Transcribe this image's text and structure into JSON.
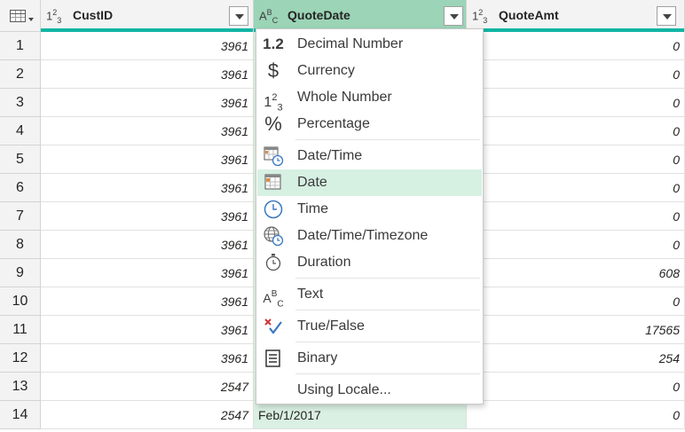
{
  "columns": [
    {
      "type_icon": "whole-number",
      "title": "CustID"
    },
    {
      "type_icon": "text",
      "title": "QuoteDate"
    },
    {
      "type_icon": "whole-number",
      "title": "QuoteAmt"
    }
  ],
  "type_glyphs": {
    "whole": "1",
    "whole_sup": "2",
    "whole_sub": "3",
    "text_a": "A",
    "text_b": "B",
    "text_c": "C"
  },
  "rows": [
    {
      "n": "1",
      "custid": "3961",
      "quotedate": "",
      "quoteamt": "0"
    },
    {
      "n": "2",
      "custid": "3961",
      "quotedate": "",
      "quoteamt": "0"
    },
    {
      "n": "3",
      "custid": "3961",
      "quotedate": "",
      "quoteamt": "0"
    },
    {
      "n": "4",
      "custid": "3961",
      "quotedate": "",
      "quoteamt": "0"
    },
    {
      "n": "5",
      "custid": "3961",
      "quotedate": "",
      "quoteamt": "0"
    },
    {
      "n": "6",
      "custid": "3961",
      "quotedate": "",
      "quoteamt": "0"
    },
    {
      "n": "7",
      "custid": "3961",
      "quotedate": "",
      "quoteamt": "0"
    },
    {
      "n": "8",
      "custid": "3961",
      "quotedate": "",
      "quoteamt": "0"
    },
    {
      "n": "9",
      "custid": "3961",
      "quotedate": "",
      "quoteamt": "608"
    },
    {
      "n": "10",
      "custid": "3961",
      "quotedate": "",
      "quoteamt": "0"
    },
    {
      "n": "11",
      "custid": "3961",
      "quotedate": "",
      "quoteamt": "17565"
    },
    {
      "n": "12",
      "custid": "3961",
      "quotedate": "",
      "quoteamt": "254"
    },
    {
      "n": "13",
      "custid": "2547",
      "quotedate": "",
      "quoteamt": "0"
    },
    {
      "n": "14",
      "custid": "2547",
      "quotedate": "Feb/1/2017",
      "quoteamt": "0"
    }
  ],
  "menu": {
    "items": [
      {
        "icon": "decimal-number",
        "glyph": "1.2",
        "label": "Decimal Number"
      },
      {
        "icon": "currency",
        "glyph": "$",
        "label": "Currency"
      },
      {
        "icon": "whole-number",
        "glyph": "123",
        "label": "Whole Number"
      },
      {
        "icon": "percentage",
        "glyph": "%",
        "label": "Percentage"
      },
      {
        "icon": "date-time",
        "glyph": "",
        "label": "Date/Time"
      },
      {
        "icon": "date",
        "glyph": "",
        "label": "Date"
      },
      {
        "icon": "time",
        "glyph": "",
        "label": "Time"
      },
      {
        "icon": "date-time-timezone",
        "glyph": "",
        "label": "Date/Time/Timezone"
      },
      {
        "icon": "duration",
        "glyph": "",
        "label": "Duration"
      },
      {
        "icon": "text",
        "glyph": "ABC",
        "label": "Text"
      },
      {
        "icon": "true-false",
        "glyph": "",
        "label": "True/False"
      },
      {
        "icon": "binary",
        "glyph": "",
        "label": "Binary"
      },
      {
        "icon": "locale",
        "glyph": "",
        "label": "Using Locale..."
      }
    ],
    "highlighted": "Date"
  },
  "colors": {
    "accent_bar": "#0fb5a3",
    "selected_header": "#9bd4b6",
    "selected_column": "#daf0e2",
    "menu_highlight": "#d6f0e2"
  }
}
